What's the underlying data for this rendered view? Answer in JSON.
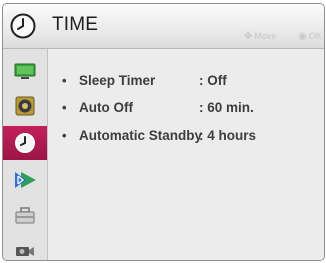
{
  "header": {
    "title": "TIME",
    "hint_move": "Move",
    "hint_ok": "OK"
  },
  "sidebar": {
    "items": [
      {
        "icon": "monitor-icon"
      },
      {
        "icon": "speaker-icon"
      },
      {
        "icon": "clock-icon",
        "active": true
      },
      {
        "icon": "bluetooth-icon"
      },
      {
        "icon": "toolbox-icon"
      },
      {
        "icon": "camera-icon"
      }
    ]
  },
  "menu": {
    "items": [
      {
        "bullet": "•",
        "label": "Sleep Timer",
        "value": ": Off"
      },
      {
        "bullet": "•",
        "label": "Auto Off",
        "value": ": 60 min."
      },
      {
        "bullet": "•",
        "label": "Automatic Standby",
        "value": ": 4 hours"
      }
    ]
  },
  "colors": {
    "accent": "#b01c50",
    "background": "#ececec",
    "text": "#3d3d3d"
  }
}
